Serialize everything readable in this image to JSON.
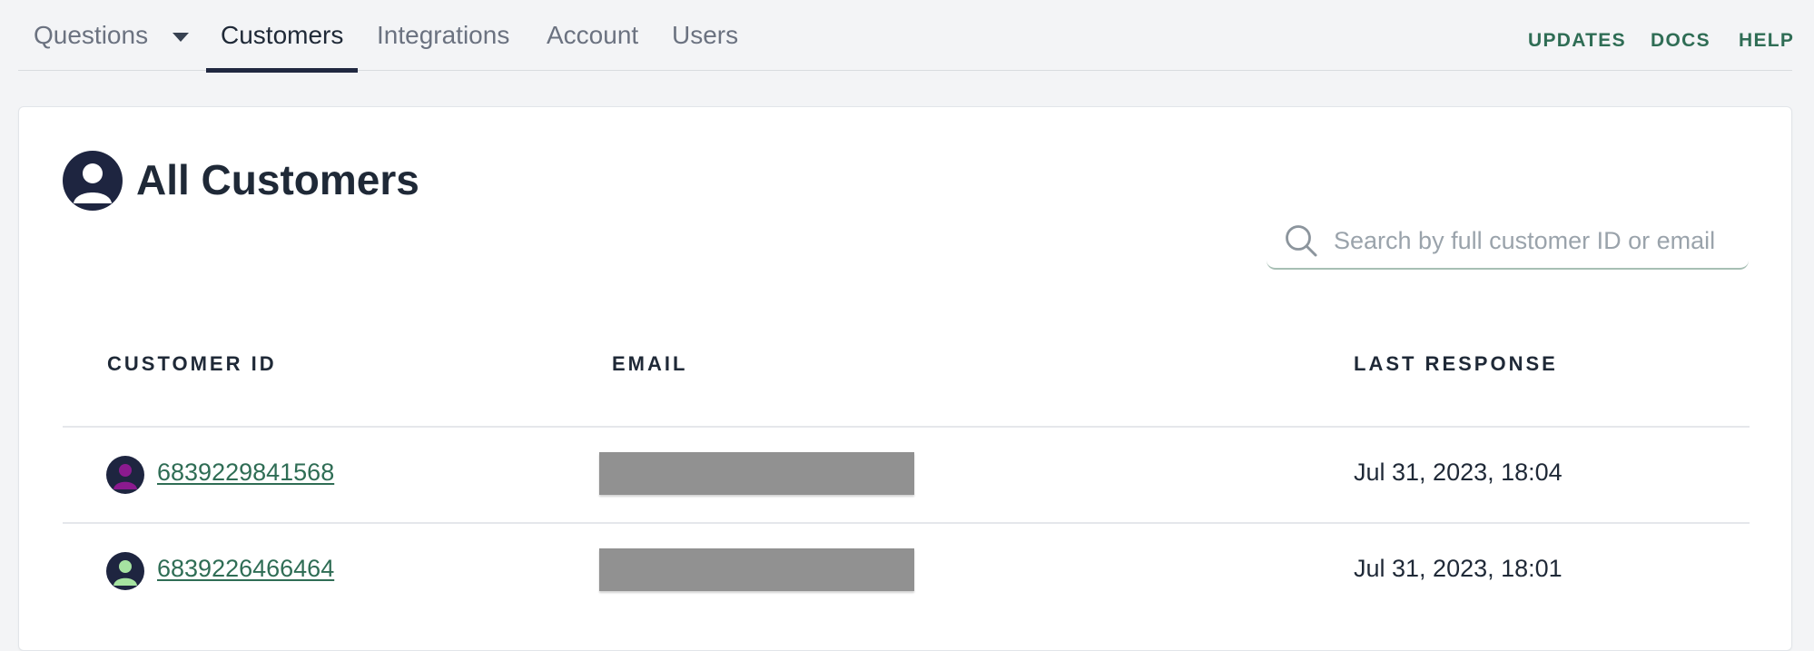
{
  "nav": {
    "tabs": [
      {
        "label": "Questions",
        "has_dropdown": true
      },
      {
        "label": "Customers",
        "active": true
      },
      {
        "label": "Integrations"
      },
      {
        "label": "Account"
      },
      {
        "label": "Users"
      }
    ],
    "links": [
      "UPDATES",
      "DOCS",
      "HELP"
    ]
  },
  "page": {
    "title": "All Customers",
    "icon": "user-avatar-icon"
  },
  "search": {
    "placeholder": "Search by full customer ID or email",
    "value": ""
  },
  "table": {
    "columns": [
      "CUSTOMER ID",
      "EMAIL",
      "LAST RESPONSE"
    ],
    "rows": [
      {
        "customer_id": "6839229841568",
        "email_redacted": true,
        "last_response": "Jul 31, 2023, 18:04",
        "avatar_color": "#8b1a8f"
      },
      {
        "customer_id": "6839226466464",
        "email_redacted": true,
        "last_response": "Jul 31, 2023, 18:01",
        "avatar_color": "#a6e3a1"
      }
    ]
  },
  "colors": {
    "accent": "#2f6d55",
    "nav_active_underline": "#202840",
    "avatar_bg": "#1e2540",
    "redaction": "#919191"
  }
}
